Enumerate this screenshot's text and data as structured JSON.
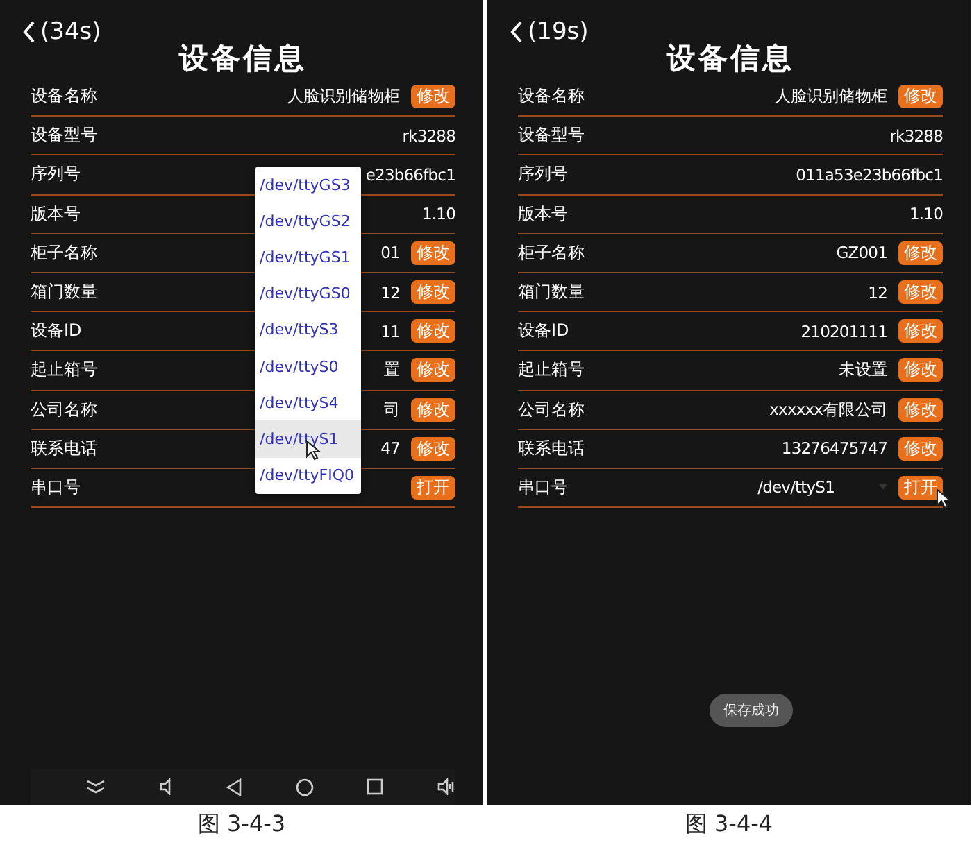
{
  "screens": [
    {
      "back": "(34s)",
      "title": "设备信息",
      "nav_bar": true,
      "caption": "图 3-4-3",
      "rows": [
        {
          "kind": "edit",
          "label": "设备名称",
          "value": "人脸识别储物柜",
          "button": "修改"
        },
        {
          "kind": "plain",
          "label": "设备型号",
          "value": "rk3288"
        },
        {
          "kind": "plain",
          "label": "序列号",
          "value": "e23b66fbc1"
        },
        {
          "kind": "plain",
          "label": "版本号",
          "value": "1.10"
        },
        {
          "kind": "edit",
          "label": "柜子名称",
          "value": "01",
          "button": "修改"
        },
        {
          "kind": "edit",
          "label": "箱门数量",
          "value": "12",
          "button": "修改"
        },
        {
          "kind": "edit",
          "label": "设备ID",
          "value": "11",
          "button": "修改"
        },
        {
          "kind": "edit",
          "label": "起止箱号",
          "value": "置",
          "button": "修改"
        },
        {
          "kind": "edit",
          "label": "公司名称",
          "value": "司",
          "button": "修改"
        },
        {
          "kind": "edit",
          "label": "联系电话",
          "value": "47",
          "button": "修改"
        },
        {
          "kind": "spinner",
          "label": "串口号",
          "button": "打开",
          "cursor": false
        }
      ],
      "dropdown": {
        "items": [
          {
            "label": "/dev/ttyGS3",
            "selected": false,
            "cursor": false
          },
          {
            "label": "/dev/ttyGS2",
            "selected": false,
            "cursor": false
          },
          {
            "label": "/dev/ttyGS1",
            "selected": false,
            "cursor": false
          },
          {
            "label": "/dev/ttyGS0",
            "selected": false,
            "cursor": false
          },
          {
            "label": "/dev/ttyS3",
            "selected": false,
            "cursor": false
          },
          {
            "label": "/dev/ttyS0",
            "selected": false,
            "cursor": false
          },
          {
            "label": "/dev/ttyS4",
            "selected": false,
            "cursor": false
          },
          {
            "label": "/dev/ttyS1",
            "selected": true,
            "cursor": true
          },
          {
            "label": "/dev/ttyFIQ0",
            "selected": false,
            "cursor": false
          }
        ]
      }
    },
    {
      "back": "(19s)",
      "title": "设备信息",
      "caption": "图 3-4-4",
      "toast": "保存成功",
      "rows": [
        {
          "kind": "edit",
          "label": "设备名称",
          "value": "人脸识别储物柜",
          "button": "修改"
        },
        {
          "kind": "plain",
          "label": "设备型号",
          "value": "rk3288"
        },
        {
          "kind": "plain",
          "label": "序列号",
          "value": "011a53e23b66fbc1"
        },
        {
          "kind": "plain",
          "label": "版本号",
          "value": "1.10"
        },
        {
          "kind": "edit",
          "label": "柜子名称",
          "value": "GZ001",
          "button": "修改"
        },
        {
          "kind": "edit",
          "label": "箱门数量",
          "value": "12",
          "button": "修改"
        },
        {
          "kind": "edit",
          "label": "设备ID",
          "value": "210201111",
          "button": "修改"
        },
        {
          "kind": "edit",
          "label": "起止箱号",
          "value": "未设置",
          "button": "修改"
        },
        {
          "kind": "edit",
          "label": "公司名称",
          "value": "xxxxxx有限公司",
          "button": "修改"
        },
        {
          "kind": "edit",
          "label": "联系电话",
          "value": "13276475747",
          "button": "修改"
        },
        {
          "kind": "spinner",
          "label": "串口号",
          "value": "/dev/ttyS1",
          "button": "打开",
          "cursor": true
        }
      ]
    }
  ]
}
